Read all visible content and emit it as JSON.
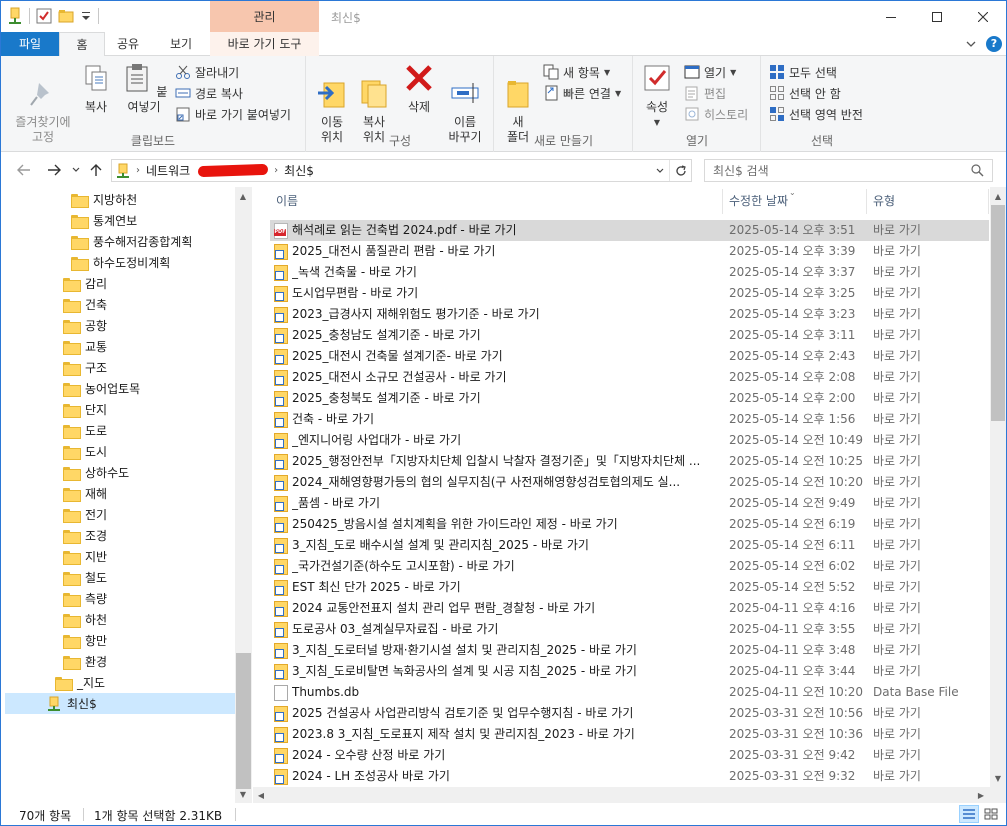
{
  "window": {
    "context_tab_title": "관리",
    "title": "최신$"
  },
  "ribbon_tabs": [
    "파일",
    "홈",
    "공유",
    "보기",
    "바로 가기 도구"
  ],
  "clipboard": {
    "pin": "즐겨찾기에\n고정",
    "copy": "복사",
    "paste": "붙여넣기",
    "cut": "잘라내기",
    "copy_path": "경로 복사",
    "paste_shortcut": "바로 가기 붙여넣기",
    "label": "클립보드"
  },
  "organize": {
    "move_to": "이동\n위치",
    "copy_to": "복사\n위치",
    "delete": "삭제",
    "rename": "이름\n바꾸기",
    "label": "구성"
  },
  "new": {
    "new_folder": "새\n폴더",
    "new_item": "새 항목",
    "easy_access": "빠른 연결",
    "label": "새로 만들기"
  },
  "open": {
    "properties": "속성",
    "open": "열기",
    "edit": "편집",
    "history": "히스토리",
    "label": "열기"
  },
  "select": {
    "select_all": "모두 선택",
    "select_none": "선택 안 함",
    "invert": "선택 영역 반전",
    "label": "선택"
  },
  "address": {
    "crumbs": [
      "네트워크",
      "최신$"
    ]
  },
  "search": {
    "placeholder": "최신$ 검색"
  },
  "nav_tree": [
    {
      "label": "지방하천",
      "level": 2
    },
    {
      "label": "통계연보",
      "level": 2
    },
    {
      "label": "풍수해저감종합계획",
      "level": 2
    },
    {
      "label": "하수도정비계획",
      "level": 2
    },
    {
      "label": "감리",
      "level": 1
    },
    {
      "label": "건축",
      "level": 1
    },
    {
      "label": "공항",
      "level": 1
    },
    {
      "label": "교통",
      "level": 1
    },
    {
      "label": "구조",
      "level": 1
    },
    {
      "label": "농어업토목",
      "level": 1
    },
    {
      "label": "단지",
      "level": 1
    },
    {
      "label": "도로",
      "level": 1
    },
    {
      "label": "도시",
      "level": 1
    },
    {
      "label": "상하수도",
      "level": 1
    },
    {
      "label": "재해",
      "level": 1
    },
    {
      "label": "전기",
      "level": 1
    },
    {
      "label": "조경",
      "level": 1
    },
    {
      "label": "지반",
      "level": 1
    },
    {
      "label": "철도",
      "level": 1
    },
    {
      "label": "측량",
      "level": 1
    },
    {
      "label": "하천",
      "level": 1
    },
    {
      "label": "항만",
      "level": 1
    },
    {
      "label": "환경",
      "level": 1
    },
    {
      "label": "_지도",
      "level": 0
    },
    {
      "label": "최신$",
      "level": -1,
      "selected": true
    }
  ],
  "columns": {
    "name": "이름",
    "date": "수정한 날짜",
    "type": "유형"
  },
  "files": [
    {
      "name": "해석례로 읽는 건축법 2024.pdf - 바로 가기",
      "date": "2025-05-14 오후 3:51",
      "type": "바로 가기",
      "icon": "pdf",
      "selected": true
    },
    {
      "name": "2025_대전시 품질관리 편람 - 바로 가기",
      "date": "2025-05-14 오후 3:39",
      "type": "바로 가기",
      "icon": "shortcut"
    },
    {
      "name": "_녹색 건축물 - 바로 가기",
      "date": "2025-05-14 오후 3:37",
      "type": "바로 가기",
      "icon": "shortcut"
    },
    {
      "name": "도시업무편람 - 바로 가기",
      "date": "2025-05-14 오후 3:25",
      "type": "바로 가기",
      "icon": "shortcut"
    },
    {
      "name": "2023_급경사지 재해위험도 평가기준 - 바로 가기",
      "date": "2025-05-14 오후 3:23",
      "type": "바로 가기",
      "icon": "shortcut"
    },
    {
      "name": "2025_충청남도 설계기준 - 바로 가기",
      "date": "2025-05-14 오후 3:11",
      "type": "바로 가기",
      "icon": "shortcut"
    },
    {
      "name": "2025_대전시 건축물 설계기준- 바로 가기",
      "date": "2025-05-14 오후 2:43",
      "type": "바로 가기",
      "icon": "shortcut"
    },
    {
      "name": "2025_대전시 소규모 건설공사 - 바로 가기",
      "date": "2025-05-14 오후 2:08",
      "type": "바로 가기",
      "icon": "shortcut"
    },
    {
      "name": "2025_충청북도 설계기준 - 바로 가기",
      "date": "2025-05-14 오후 2:00",
      "type": "바로 가기",
      "icon": "shortcut"
    },
    {
      "name": "건축 - 바로 가기",
      "date": "2025-05-14 오후 1:56",
      "type": "바로 가기",
      "icon": "shortcut"
    },
    {
      "name": "_엔지니어링 사업대가 - 바로 가기",
      "date": "2025-05-14 오전 10:49",
      "type": "바로 가기",
      "icon": "shortcut"
    },
    {
      "name": "2025_행정안전부「지방자치단체 입찰시 낙찰자 결정기준」및「지방자치단체 ...",
      "date": "2025-05-14 오전 10:25",
      "type": "바로 가기",
      "icon": "shortcut"
    },
    {
      "name": "2024_재해영향평가등의 협의 실무지침(구 사전재해영향성검토협의제도 실...",
      "date": "2025-05-14 오전 10:20",
      "type": "바로 가기",
      "icon": "shortcut"
    },
    {
      "name": "_품셈 - 바로 가기",
      "date": "2025-05-14 오전 9:49",
      "type": "바로 가기",
      "icon": "shortcut"
    },
    {
      "name": "250425_방음시설 설치계획을 위한 가이드라인 제정 - 바로 가기",
      "date": "2025-05-14 오전 6:19",
      "type": "바로 가기",
      "icon": "shortcut"
    },
    {
      "name": "3_지침_도로 배수시설 설계 및 관리지침_2025 - 바로 가기",
      "date": "2025-05-14 오전 6:11",
      "type": "바로 가기",
      "icon": "shortcut"
    },
    {
      "name": "_국가건설기준(하수도 고시포함) - 바로 가기",
      "date": "2025-05-14 오전 6:02",
      "type": "바로 가기",
      "icon": "shortcut"
    },
    {
      "name": "EST 최신 단가 2025 - 바로 가기",
      "date": "2025-05-14 오전 5:52",
      "type": "바로 가기",
      "icon": "shortcut"
    },
    {
      "name": "2024 교통안전표지 설치 관리 업무 편람_경찰청 - 바로 가기",
      "date": "2025-04-11 오후 4:16",
      "type": "바로 가기",
      "icon": "shortcut"
    },
    {
      "name": "도로공사 03_설계실무자료집 - 바로 가기",
      "date": "2025-04-11 오후 3:55",
      "type": "바로 가기",
      "icon": "shortcut"
    },
    {
      "name": "3_지침_도로터널 방재·환기시설 설치 및 관리지침_2025 - 바로 가기",
      "date": "2025-04-11 오후 3:48",
      "type": "바로 가기",
      "icon": "shortcut"
    },
    {
      "name": "3_지침_도로비탈면 녹화공사의 설계 및 시공 지침_2025 - 바로 가기",
      "date": "2025-04-11 오후 3:44",
      "type": "바로 가기",
      "icon": "shortcut"
    },
    {
      "name": "Thumbs.db",
      "date": "2025-04-11 오전 10:20",
      "type": "Data Base File",
      "icon": "db"
    },
    {
      "name": "2025 건설공사 사업관리방식 검토기준 및 업무수행지침 - 바로 가기",
      "date": "2025-03-31 오전 10:56",
      "type": "바로 가기",
      "icon": "shortcut"
    },
    {
      "name": "2023.8 3_지침_도로표지 제작 설치 및 관리지침_2023 - 바로 가기",
      "date": "2025-03-31 오전 10:36",
      "type": "바로 가기",
      "icon": "shortcut"
    },
    {
      "name": "2024 - 오수량 산정 바로 가기",
      "date": "2025-03-31 오전 9:42",
      "type": "바로 가기",
      "icon": "shortcut"
    },
    {
      "name": "2024 - LH 조성공사 바로 가기",
      "date": "2025-03-31 오전 9:32",
      "type": "바로 가기",
      "icon": "shortcut"
    }
  ],
  "status": {
    "item_count": "70개 항목",
    "selection": "1개 항목 선택함 2.31KB"
  }
}
